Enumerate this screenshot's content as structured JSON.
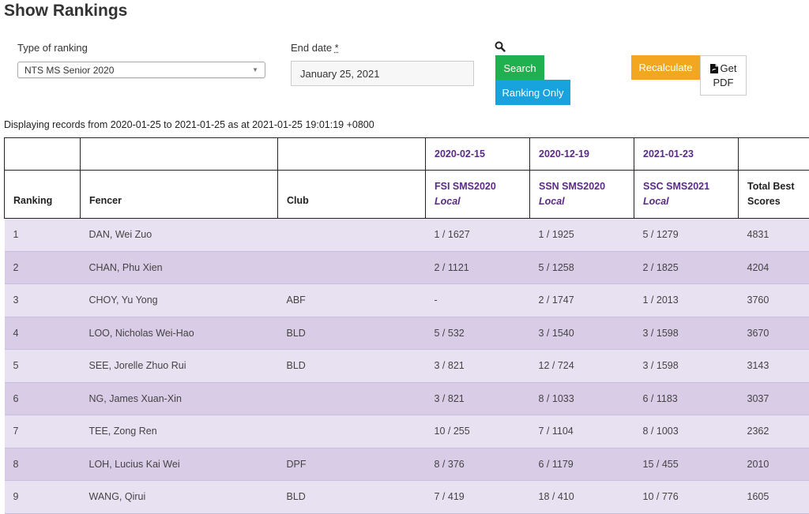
{
  "page": {
    "title": "Show Rankings"
  },
  "form": {
    "ranking_type_label": "Type of ranking",
    "ranking_type_value": "NTS MS Senior 2020",
    "end_date_label": "End date",
    "end_date_required": "*",
    "end_date_value": "January 25, 2021"
  },
  "buttons": {
    "search": "Search",
    "ranking_only": "Ranking Only",
    "recalculate": "Recalculate",
    "get_pdf_line1": "Get",
    "get_pdf_line2": "PDF"
  },
  "display_info": "Displaying records from 2020-01-25 to 2021-01-25 as at 2021-01-25 19:01:19 +0800",
  "table": {
    "event_dates": [
      "2020-02-15",
      "2020-12-19",
      "2021-01-23"
    ],
    "headers": {
      "ranking": "Ranking",
      "fencer": "Fencer",
      "club": "Club",
      "total_line1": "Total Best",
      "total_line2": "Scores"
    },
    "events": [
      {
        "name": "FSI SMS2020",
        "type": "Local"
      },
      {
        "name": "SSN SMS2020",
        "type": "Local"
      },
      {
        "name": "SSC SMS2021",
        "type": "Local"
      }
    ],
    "rows": [
      {
        "rank": "1",
        "fencer": "DAN, Wei Zuo",
        "club": "",
        "e1": "1 / 1627",
        "e2": "1 / 1925",
        "e3": "5 / 1279",
        "total": "4831"
      },
      {
        "rank": "2",
        "fencer": "CHAN, Phu Xien",
        "club": "",
        "e1": "2 / 1121",
        "e2": "5 / 1258",
        "e3": "2 / 1825",
        "total": "4204"
      },
      {
        "rank": "3",
        "fencer": "CHOY, Yu Yong",
        "club": "ABF",
        "e1": "-",
        "e2": "2 / 1747",
        "e3": "1 / 2013",
        "total": "3760"
      },
      {
        "rank": "4",
        "fencer": "LOO, Nicholas Wei-Hao",
        "club": "BLD",
        "e1": "5 / 532",
        "e2": "3 / 1540",
        "e3": "3 / 1598",
        "total": "3670"
      },
      {
        "rank": "5",
        "fencer": "SEE, Jorelle Zhuo Rui",
        "club": "BLD",
        "e1": "3 / 821",
        "e2": "12 / 724",
        "e3": "3 / 1598",
        "total": "3143"
      },
      {
        "rank": "6",
        "fencer": "NG, James Xuan-Xin",
        "club": "",
        "e1": "3 / 821",
        "e2": "8 / 1033",
        "e3": "6 / 1183",
        "total": "3037"
      },
      {
        "rank": "7",
        "fencer": "TEE, Zong Ren",
        "club": "",
        "e1": "10 / 255",
        "e2": "7 / 1104",
        "e3": "8 / 1003",
        "total": "2362"
      },
      {
        "rank": "8",
        "fencer": "LOH, Lucius Kai Wei",
        "club": "DPF",
        "e1": "8 / 376",
        "e2": "6 / 1179",
        "e3": "15 / 455",
        "total": "2010"
      },
      {
        "rank": "9",
        "fencer": "WANG, Qirui",
        "club": "BLD",
        "e1": "7 / 419",
        "e2": "18 / 410",
        "e3": "10 / 776",
        "total": "1605"
      }
    ]
  },
  "colors": {
    "search": "#1fb14f",
    "ranking_only": "#18a2de",
    "recalculate": "#f3a61f",
    "accent_purple": "#5a2a86",
    "row_odd": "#e8e1f2",
    "row_even": "#d8cce6"
  },
  "icons": {
    "search": "search-icon",
    "pdf": "pdf-file-icon",
    "dropdown": "chevron-down-icon"
  }
}
